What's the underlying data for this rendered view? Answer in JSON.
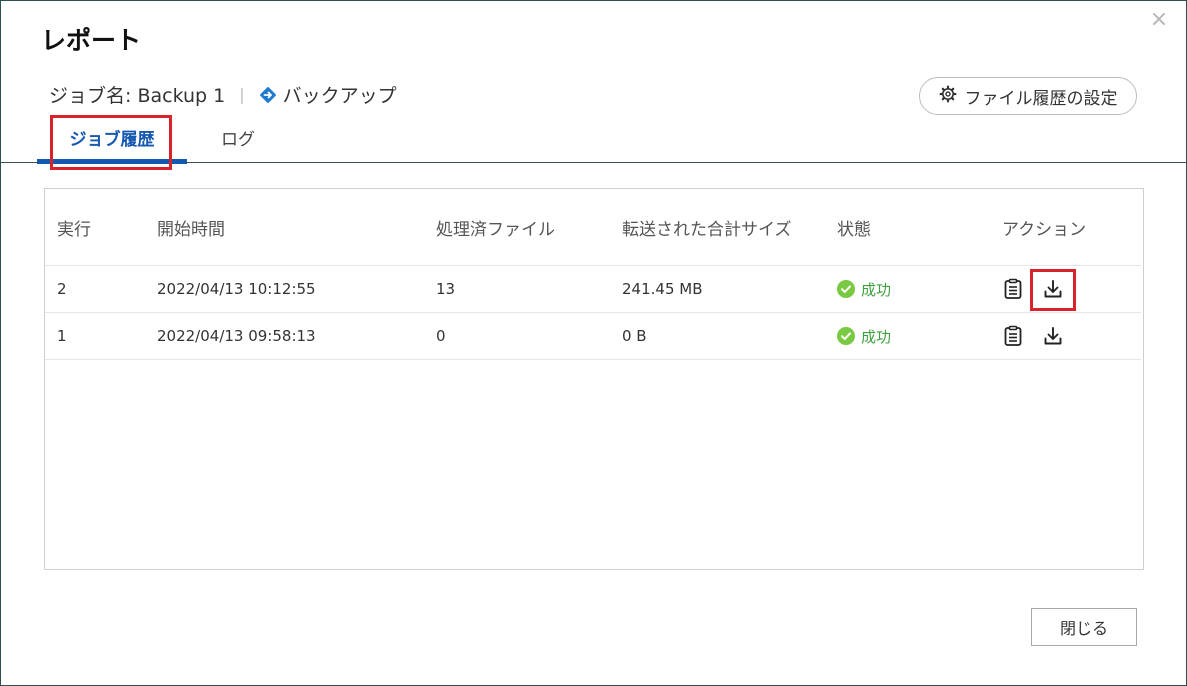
{
  "dialog": {
    "title": "レポート",
    "close_glyph": "×"
  },
  "job": {
    "name_label": "ジョブ名: Backup 1",
    "separator": "|",
    "type_icon": "diamond-arrow-icon",
    "type_label": "バックアップ"
  },
  "settings_button": {
    "icon": "gear-icon",
    "label": "ファイル履歴の設定"
  },
  "tabs": [
    {
      "label": "ジョブ履歴",
      "active": true
    },
    {
      "label": "ログ",
      "active": false
    }
  ],
  "table": {
    "headers": [
      "実行",
      "開始時間",
      "処理済ファイル",
      "転送された合計サイズ",
      "状態",
      "アクション"
    ],
    "rows": [
      {
        "run": "2",
        "start": "2022/04/13 10:12:55",
        "files": "13",
        "size": "241.45 MB",
        "status": "成功"
      },
      {
        "run": "1",
        "start": "2022/04/13 09:58:13",
        "files": "0",
        "size": "0 B",
        "status": "成功"
      }
    ]
  },
  "footer": {
    "close_label": "閉じる"
  },
  "colors": {
    "accent": "#1558b0",
    "success": "#3fa03f",
    "highlight": "#d8232a"
  }
}
